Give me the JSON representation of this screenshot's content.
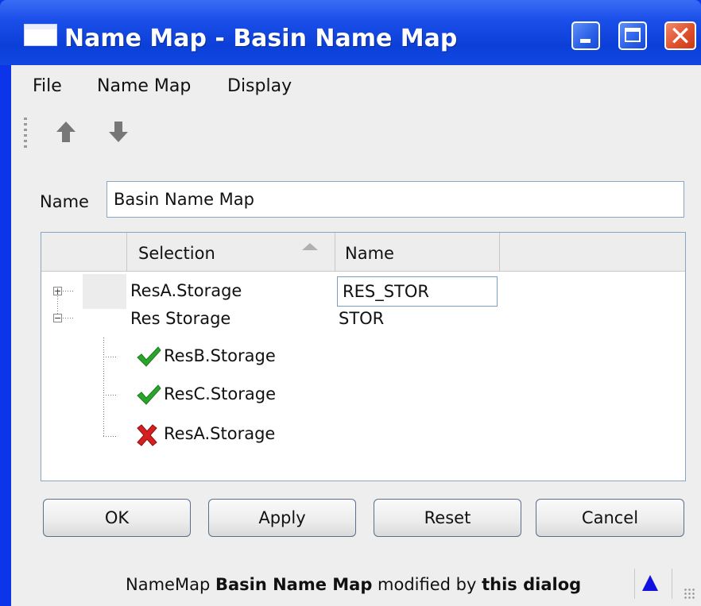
{
  "window": {
    "title": "Name Map - Basin Name Map"
  },
  "menu": {
    "items": [
      "File",
      "Name Map",
      "Display"
    ]
  },
  "toolbar": {
    "move_up": "up-arrow-icon",
    "move_down": "down-arrow-icon"
  },
  "form": {
    "name_label": "Name",
    "name_value": "Basin Name Map"
  },
  "table": {
    "headers": {
      "selection": "Selection",
      "name": "Name"
    },
    "rows": [
      {
        "selection": "ResA.Storage",
        "name": "RES_STOR",
        "expanded": false
      },
      {
        "selection": "Res Storage",
        "name": "STOR",
        "expanded": true,
        "children": [
          {
            "selection": "ResB.Storage",
            "status": "check"
          },
          {
            "selection": "ResC.Storage",
            "status": "check"
          },
          {
            "selection": "ResA.Storage",
            "status": "error"
          }
        ]
      }
    ]
  },
  "buttons": {
    "ok": "OK",
    "apply": "Apply",
    "reset": "Reset",
    "cancel": "Cancel"
  },
  "status": {
    "prefix": "NameMap ",
    "map_name": "Basin Name Map",
    "middle": " modified by ",
    "actor": "this dialog"
  },
  "colors": {
    "titlebar": "#1b4fe9",
    "desktop": "#0b1be0",
    "check": "#2aa52a",
    "error": "#d62020",
    "status_arrow": "#1010e0"
  }
}
